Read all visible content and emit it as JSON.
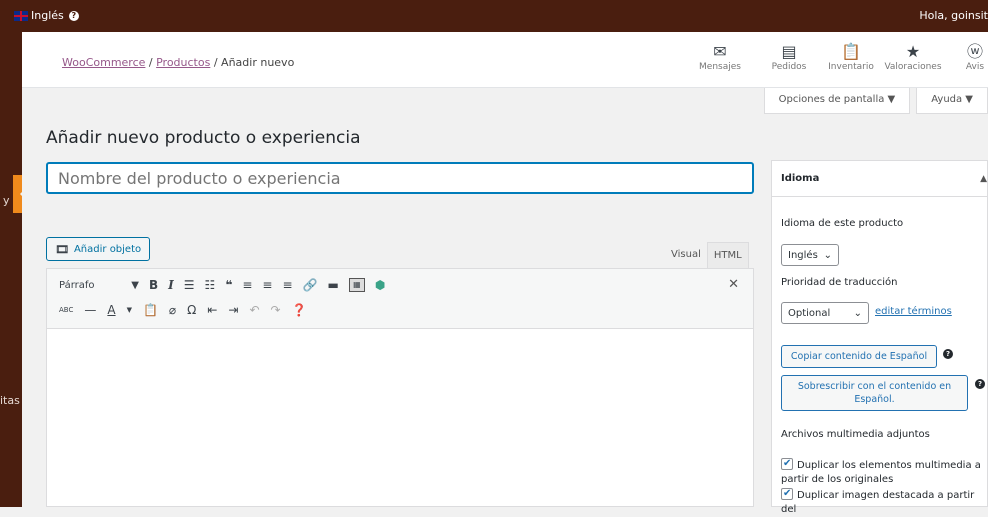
{
  "adminbar": {
    "lang_label": "Inglés",
    "greeting": "Hola, goinsit"
  },
  "sidebar": {
    "partial_label_1": "y",
    "partial_label_2": "itas"
  },
  "breadcrumb": {
    "woocommerce": "WooCommerce",
    "sep": " / ",
    "productos": "Productos",
    "current": "Añadir nuevo"
  },
  "wcnav": [
    {
      "label": "Mensajes",
      "icon": "envelope-icon",
      "glyph": "✉"
    },
    {
      "label": "Pedidos",
      "icon": "orders-icon",
      "glyph": "▤"
    },
    {
      "label": "Inventario",
      "icon": "clipboard-icon",
      "glyph": "📋"
    },
    {
      "label": "Valoraciones",
      "icon": "star-icon",
      "glyph": "★"
    },
    {
      "label": "Avis",
      "icon": "wordpress-icon",
      "glyph": "ⓦ"
    }
  ],
  "screen_options": {
    "options": "Opciones de pantalla ▼",
    "help": "Ayuda ▼"
  },
  "page": {
    "title": "Añadir nuevo producto o experiencia",
    "title_placeholder": "Nombre del producto o experiencia"
  },
  "editor": {
    "add_media": "Añadir objeto",
    "tab_visual": "Visual",
    "tab_html": "HTML",
    "format_select": "Párrafo"
  },
  "language_panel": {
    "title": "Idioma",
    "product_language_label": "Idioma de este producto",
    "product_language_value": "Inglés",
    "priority_label": "Prioridad de traducción",
    "priority_value": "Optional",
    "edit_terms": "editar términos",
    "copy_button": "Copiar contenido de Español",
    "overwrite_button": "Sobrescribir con el contenido en Español.",
    "media_label": "Archivos multimedia adjuntos",
    "check_duplicate_media": "Duplicar los elementos multimedia a partir de los originales",
    "check_duplicate_featured": "Duplicar imagen destacada a partir del"
  },
  "colors": {
    "adminbar": "#4a1e0f",
    "accent": "#96588a",
    "link": "#2271b1",
    "focus": "#007cba"
  }
}
